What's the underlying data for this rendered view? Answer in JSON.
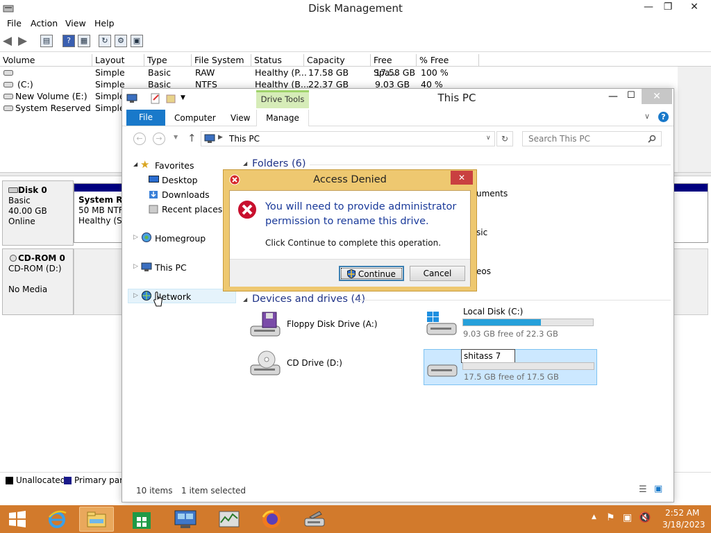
{
  "disk_management": {
    "title": "Disk Management",
    "window_controls": {
      "minimize": "—",
      "restore": "❐",
      "close": "✕"
    },
    "menu": [
      "File",
      "Action",
      "View",
      "Help"
    ],
    "columns": [
      "Volume",
      "Layout",
      "Type",
      "File System",
      "Status",
      "Capacity",
      "Free Spa...",
      "% Free"
    ],
    "rows": [
      [
        "",
        "Simple",
        "Basic",
        "RAW",
        "Healthy (P...",
        "17.58 GB",
        "17.58 GB",
        "100 %"
      ],
      [
        "(C:)",
        "Simple",
        "Basic",
        "NTFS",
        "Healthy (B...",
        "22.37 GB",
        "9.03 GB",
        "40 %"
      ],
      [
        "New Volume (E:)",
        "Simple",
        "",
        "",
        "",
        "",
        "",
        ""
      ],
      [
        "System Reserved",
        "Simple",
        "",
        "",
        "",
        "",
        "",
        ""
      ]
    ],
    "disks": [
      {
        "name": "Disk 0",
        "type": "Basic",
        "size": "40.00 GB",
        "state": "Online",
        "partition_name": "System Re",
        "partition_detail": "50 MB NTF",
        "partition_status": "Healthy (Sy"
      },
      {
        "name": "CD-ROM 0",
        "type": "CD-ROM (D:)",
        "size": "",
        "state": "No Media"
      }
    ],
    "legend": [
      "Unallocated",
      "Primary parti"
    ],
    "colors": {
      "unallocated": "#000000",
      "primary": "#1a1a8a",
      "disk_bar": "#000080"
    }
  },
  "explorer": {
    "title": "This PC",
    "contextual_tab_group": "Drive Tools",
    "ribbon_tabs": [
      "File",
      "Computer",
      "View",
      "Manage"
    ],
    "address": "This PC",
    "search_placeholder": "Search This PC",
    "nav": {
      "favorites": "Favorites",
      "favorite_items": [
        "Desktop",
        "Downloads",
        "Recent places"
      ],
      "homegroup": "Homegroup",
      "this_pc": "This PC",
      "network": "Network"
    },
    "folders_header": "Folders (6)",
    "folders_partial": [
      "uments",
      "sic",
      "eos"
    ],
    "devices_header": "Devices and drives (4)",
    "drives": [
      {
        "name": "Floppy Disk Drive (A:)",
        "icon": "floppy-drive-icon"
      },
      {
        "name": "CD Drive (D:)",
        "icon": "cd-drive-icon"
      },
      {
        "name": "Local Disk (C:)",
        "free_text": "9.03 GB free of 22.3 GB",
        "used_fraction": 0.6,
        "icon": "windows-disk-icon"
      },
      {
        "name_edit": "shitass 7",
        "free_text": "17.5 GB free of 17.5 GB",
        "used_fraction": 0.0,
        "icon": "disk-icon"
      }
    ],
    "status": {
      "items": "10 items",
      "selected": "1 item selected"
    },
    "accent": "#1979ca"
  },
  "dialog": {
    "title": "Access Denied",
    "message": "You will need to provide administrator permission to rename this drive.",
    "sub": "Click Continue to complete this operation.",
    "continue_label": "Continue",
    "cancel_label": "Cancel"
  },
  "taskbar": {
    "time": "2:52 AM",
    "date": "3/18/2023",
    "color": "#d27a2c"
  }
}
